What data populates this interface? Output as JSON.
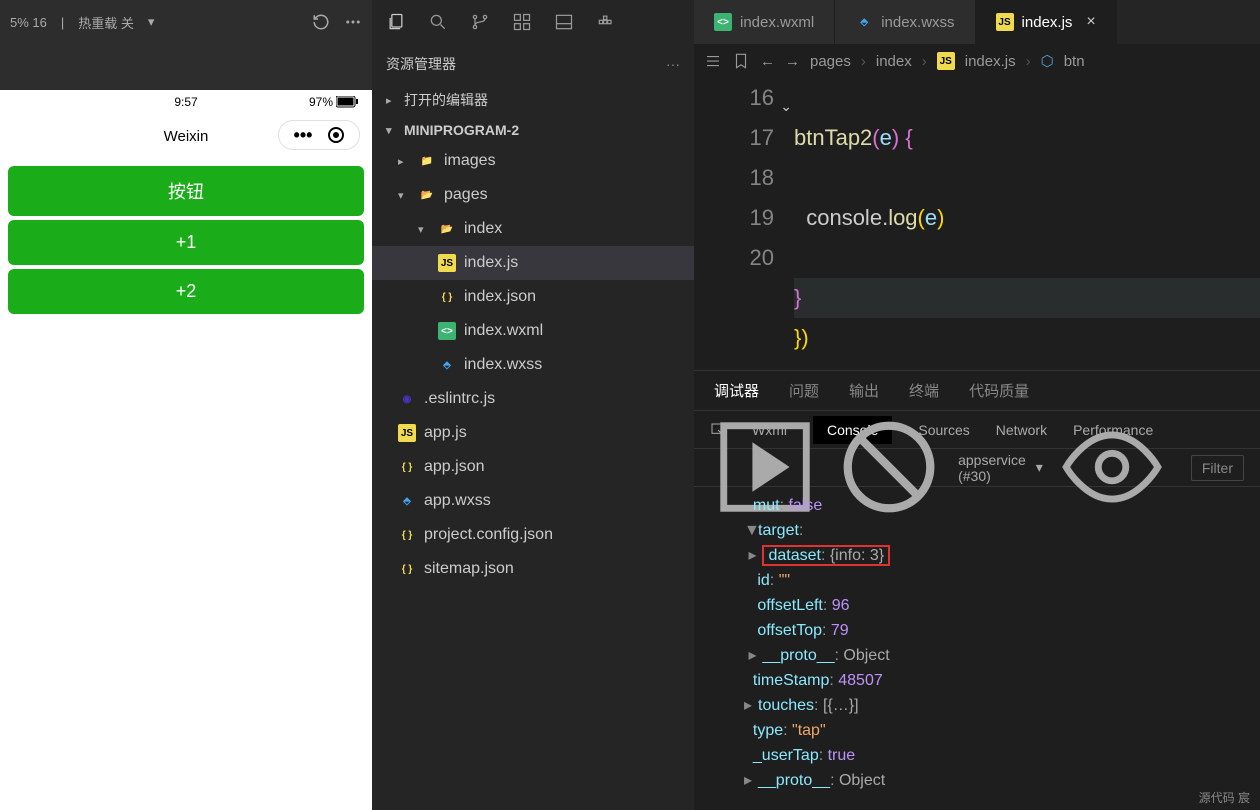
{
  "sim": {
    "top_left": "5% 16",
    "reload": "热重载 关",
    "status_time": "9:57",
    "battery": "97%",
    "app_title": "Weixin",
    "buttons": [
      "按钮",
      "+1",
      "+2"
    ]
  },
  "explorer": {
    "title": "资源管理器",
    "open_editors": "打开的编辑器",
    "project": "MINIPROGRAM-2",
    "tree": {
      "images": "images",
      "pages": "pages",
      "index": "index",
      "files": {
        "indexjs": "index.js",
        "indexjson": "index.json",
        "indexwxml": "index.wxml",
        "indexwxss": "index.wxss"
      },
      "root": {
        "eslint": ".eslintrc.js",
        "appjs": "app.js",
        "appjson": "app.json",
        "appwxss": "app.wxss",
        "projconf": "project.config.json",
        "sitemap": "sitemap.json"
      }
    }
  },
  "editor": {
    "tabs": {
      "wxml": "index.wxml",
      "wxss": "index.wxss",
      "js": "index.js"
    },
    "breadcrumb": {
      "pages": "pages",
      "index": "index",
      "file": "index.js",
      "sym": "btn"
    },
    "code": {
      "lines": [
        "16",
        "17",
        "18",
        "19",
        "20"
      ],
      "l16a": "btnTap2",
      "l16b": "(",
      "l16c": "e",
      "l16d": ") ",
      "l16e": "{",
      "l17a": "  console",
      "l17b": ".",
      "l17c": "log",
      "l17d": "(",
      "l17e": "e",
      "l17f": ")",
      "l18a": "}",
      "l19a": "}",
      "l19b": ")"
    }
  },
  "panel": {
    "tabs": {
      "t1": "调试器",
      "t2": "问题",
      "t3": "输出",
      "t4": "终端",
      "t5": "代码质量"
    },
    "devtabs": {
      "wxml": "Wxml",
      "console": "Console",
      "sources": "Sources",
      "network": "Network",
      "perf": "Performance"
    },
    "context": "appservice (#30)",
    "filter": "Filter",
    "log": {
      "mut_k": "mut",
      "mut_v": "false",
      "target_k": "target",
      "dataset_k": "dataset",
      "dataset_v": "{info: 3}",
      "id_k": "id",
      "id_v": "\"\"",
      "ol_k": "offsetLeft",
      "ol_v": "96",
      "ot_k": "offsetTop",
      "ot_v": "79",
      "proto_k": "__proto__",
      "proto_v": "Object",
      "ts_k": "timeStamp",
      "ts_v": "48507",
      "touch_k": "touches",
      "touch_v": "[{…}]",
      "type_k": "type",
      "type_v": "\"tap\"",
      "ut_k": "_userTap",
      "ut_v": "true",
      "proto2_k": "__proto__",
      "proto2_v": "Object"
    },
    "footer": "源代码  宸"
  }
}
